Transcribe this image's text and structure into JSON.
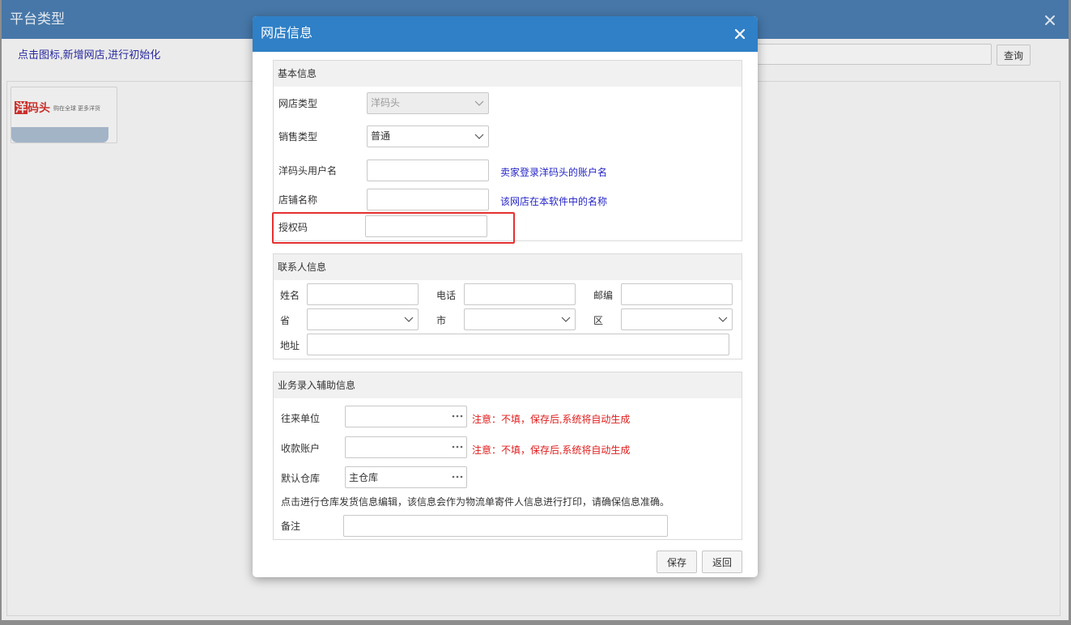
{
  "colors": {
    "modal_header": "#2f80c7",
    "highlight": "#e53030",
    "hint_text": "#2424c8",
    "note_text": "#e01b1b",
    "bg_titlebar": "#4677a8"
  },
  "background_window": {
    "title": "平台类型",
    "close_icon": "close-icon",
    "hint": "点击图标,新增网店,进行初始化",
    "search": {
      "value": ""
    },
    "query_button": "查询",
    "platforms": [
      {
        "logo_text": "洋码头",
        "logo_tagline": "购在全球 更多洋货"
      }
    ]
  },
  "modal": {
    "title": "网店信息",
    "close_icon": "close-icon",
    "basic": {
      "title": "基本信息",
      "shop_type": {
        "label": "网店类型",
        "value": "洋码头",
        "disabled": true
      },
      "sale_type": {
        "label": "销售类型",
        "value": "普通"
      },
      "username": {
        "label": "洋码头用户名",
        "value": "",
        "hint": "卖家登录洋码头的账户名"
      },
      "shop_name": {
        "label": "店铺名称",
        "value": "",
        "hint": "该网店在本软件中的名称"
      },
      "auth_code": {
        "label": "授权码",
        "value": "",
        "highlighted": true
      }
    },
    "contact": {
      "title": "联系人信息",
      "name": {
        "label": "姓名",
        "value": ""
      },
      "phone": {
        "label": "电话",
        "value": ""
      },
      "zip": {
        "label": "邮编",
        "value": ""
      },
      "province": {
        "label": "省",
        "value": ""
      },
      "city": {
        "label": "市",
        "value": ""
      },
      "district": {
        "label": "区",
        "value": ""
      },
      "address": {
        "label": "地址",
        "value": ""
      }
    },
    "business": {
      "title": "业务录入辅助信息",
      "partner": {
        "label": "往来单位",
        "value": "",
        "note": "注意：不填，保存后,系统将自动生成"
      },
      "account": {
        "label": "收款账户",
        "value": "",
        "note": "注意：不填，保存后,系统将自动生成"
      },
      "warehouse": {
        "label": "默认仓库",
        "value": "主仓库"
      },
      "info": "点击进行仓库发货信息编辑，该信息会作为物流单寄件人信息进行打印，请确保信息准确。",
      "remark": {
        "label": "备注",
        "value": ""
      },
      "more_icon": "more-icon"
    },
    "buttons": {
      "save": "保存",
      "back": "返回"
    }
  }
}
